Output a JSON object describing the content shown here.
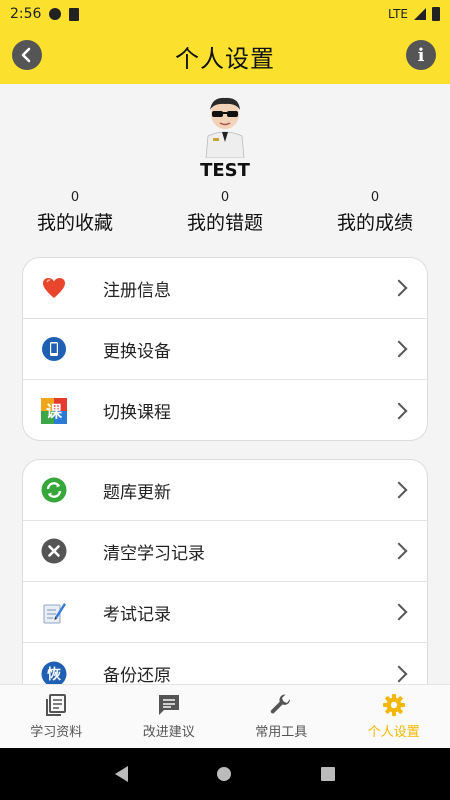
{
  "status_bar": {
    "time": "2:56",
    "network": "LTE"
  },
  "header": {
    "title": "个人设置",
    "info_glyph": "i"
  },
  "profile": {
    "username": "TEST",
    "stats": [
      {
        "count": "0",
        "label": "我的收藏"
      },
      {
        "count": "0",
        "label": "我的错题"
      },
      {
        "count": "0",
        "label": "我的成绩"
      }
    ]
  },
  "menu_group_1": [
    {
      "label": "注册信息",
      "icon": "heart-icon",
      "color": "#e8452c"
    },
    {
      "label": "更换设备",
      "icon": "phone-icon",
      "color": "#1f5fb4"
    },
    {
      "label": "切换课程",
      "icon": "course-icon",
      "icon_text": "课",
      "color": "#e35b1e"
    }
  ],
  "menu_group_2": [
    {
      "label": "题库更新",
      "icon": "refresh-icon",
      "color": "#36a83a"
    },
    {
      "label": "清空学习记录",
      "icon": "clear-icon",
      "color": "#555555"
    },
    {
      "label": "考试记录",
      "icon": "exam-record-icon",
      "color": "#3a7bd5"
    },
    {
      "label": "备份还原",
      "icon": "backup-icon",
      "icon_text": "恢",
      "color": "#1f5fb4"
    }
  ],
  "bottom_nav": [
    {
      "label": "学习资料",
      "icon": "book-icon",
      "active": false
    },
    {
      "label": "改进建议",
      "icon": "message-icon",
      "active": false
    },
    {
      "label": "常用工具",
      "icon": "wrench-icon",
      "active": false
    },
    {
      "label": "个人设置",
      "icon": "gear-icon",
      "active": true
    }
  ],
  "colors": {
    "accent": "#fbe12e",
    "active_tab": "#f5b800"
  }
}
